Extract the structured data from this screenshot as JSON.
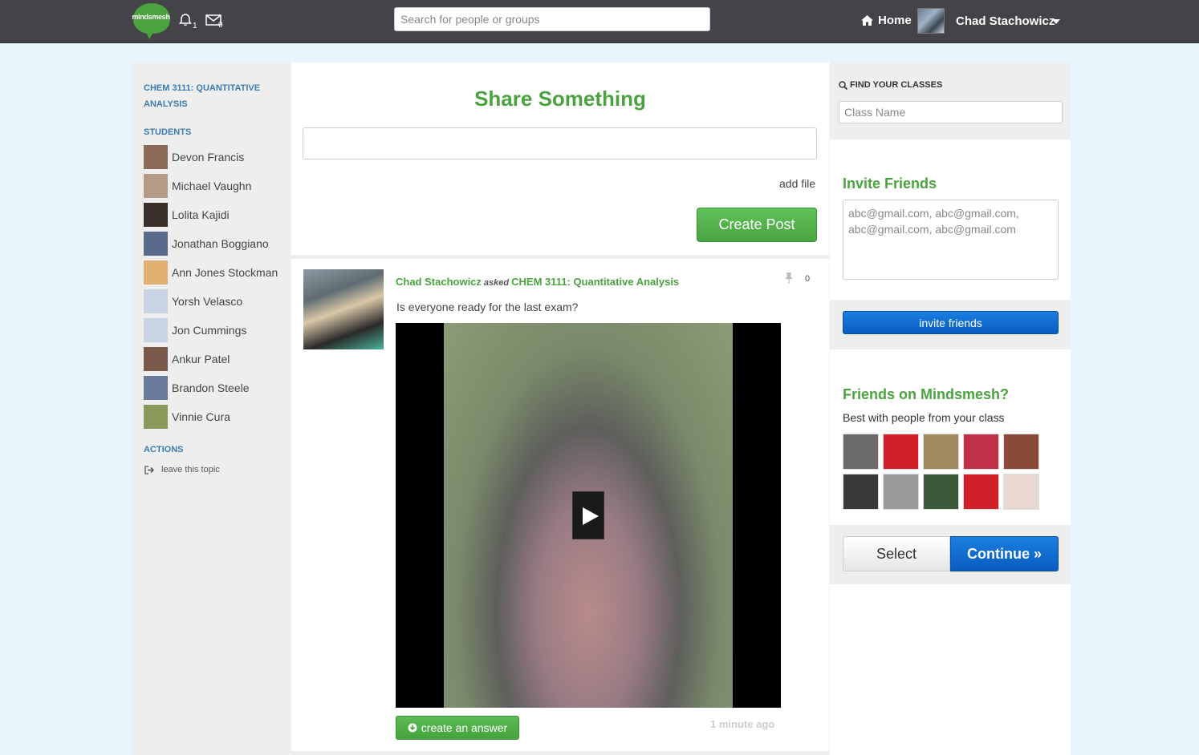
{
  "topbar": {
    "logo_text": "mindsmesh",
    "notifications_count": "1",
    "messages_count": "0",
    "search_placeholder": "Search for people or groups",
    "home_label": "Home",
    "user_name": "Chad Stachowicz"
  },
  "sidebar": {
    "class_title": "CHEM 3111: QUANTITATIVE ANALYSIS",
    "students_title": "STUDENTS",
    "students": [
      {
        "name": "Devon Francis",
        "color": "#8a6a58"
      },
      {
        "name": "Michael Vaughn",
        "color": "#b59a85"
      },
      {
        "name": "Lolita Kajidi",
        "color": "#3a2e2a"
      },
      {
        "name": "Jonathan Boggiano",
        "color": "#5a6a8a"
      },
      {
        "name": "Ann Jones Stockman",
        "color": "#e0b070"
      },
      {
        "name": "Yorsh Velasco",
        "color": "#c8d4e4"
      },
      {
        "name": "Jon Cummings",
        "color": "#c8d4e4"
      },
      {
        "name": "Ankur Patel",
        "color": "#7a5a4a"
      },
      {
        "name": "Brandon Steele",
        "color": "#6a7a9a"
      },
      {
        "name": "Vinnie Cura",
        "color": "#8a9a5a"
      }
    ],
    "actions_title": "ACTIONS",
    "leave_label": "leave this topic"
  },
  "share": {
    "title": "Share Something",
    "add_file": "add file",
    "create_post": "Create Post"
  },
  "post": {
    "author": "Chad Stachowicz",
    "verb": "asked",
    "target": "CHEM 3111: Quantitative Analysis",
    "pin_count": "0",
    "text": "Is everyone ready for the last exam?",
    "answer_label": "create an answer",
    "time": "1 minute ago"
  },
  "right": {
    "find_title": "FIND YOUR CLASSES",
    "class_placeholder": "Class Name",
    "invite_title": "Invite Friends",
    "invite_placeholder": "abc@gmail.com, abc@gmail.com, abc@gmail.com, abc@gmail.com",
    "invite_button": "invite friends",
    "friends_title": "Friends on Mindsmesh?",
    "friends_sub": "Best with people from your class",
    "friends": [
      {
        "color": "#6a6a6a"
      },
      {
        "color": "#d0202a"
      },
      {
        "color": "#a08a60"
      },
      {
        "color": "#c03048"
      },
      {
        "color": "#8a4a3a"
      },
      {
        "color": "#3a3a3a"
      },
      {
        "color": "#9a9a9a"
      },
      {
        "color": "#3a5a3a"
      },
      {
        "color": "#d0202a"
      },
      {
        "color": "#e8d8d0"
      }
    ],
    "select_label": "Select",
    "continue_label": "Continue »"
  },
  "colors": {
    "green": "#4aa33f",
    "blue": "#0a5cc0",
    "link_blue": "#3b7bb0",
    "topbar": "#444448"
  }
}
